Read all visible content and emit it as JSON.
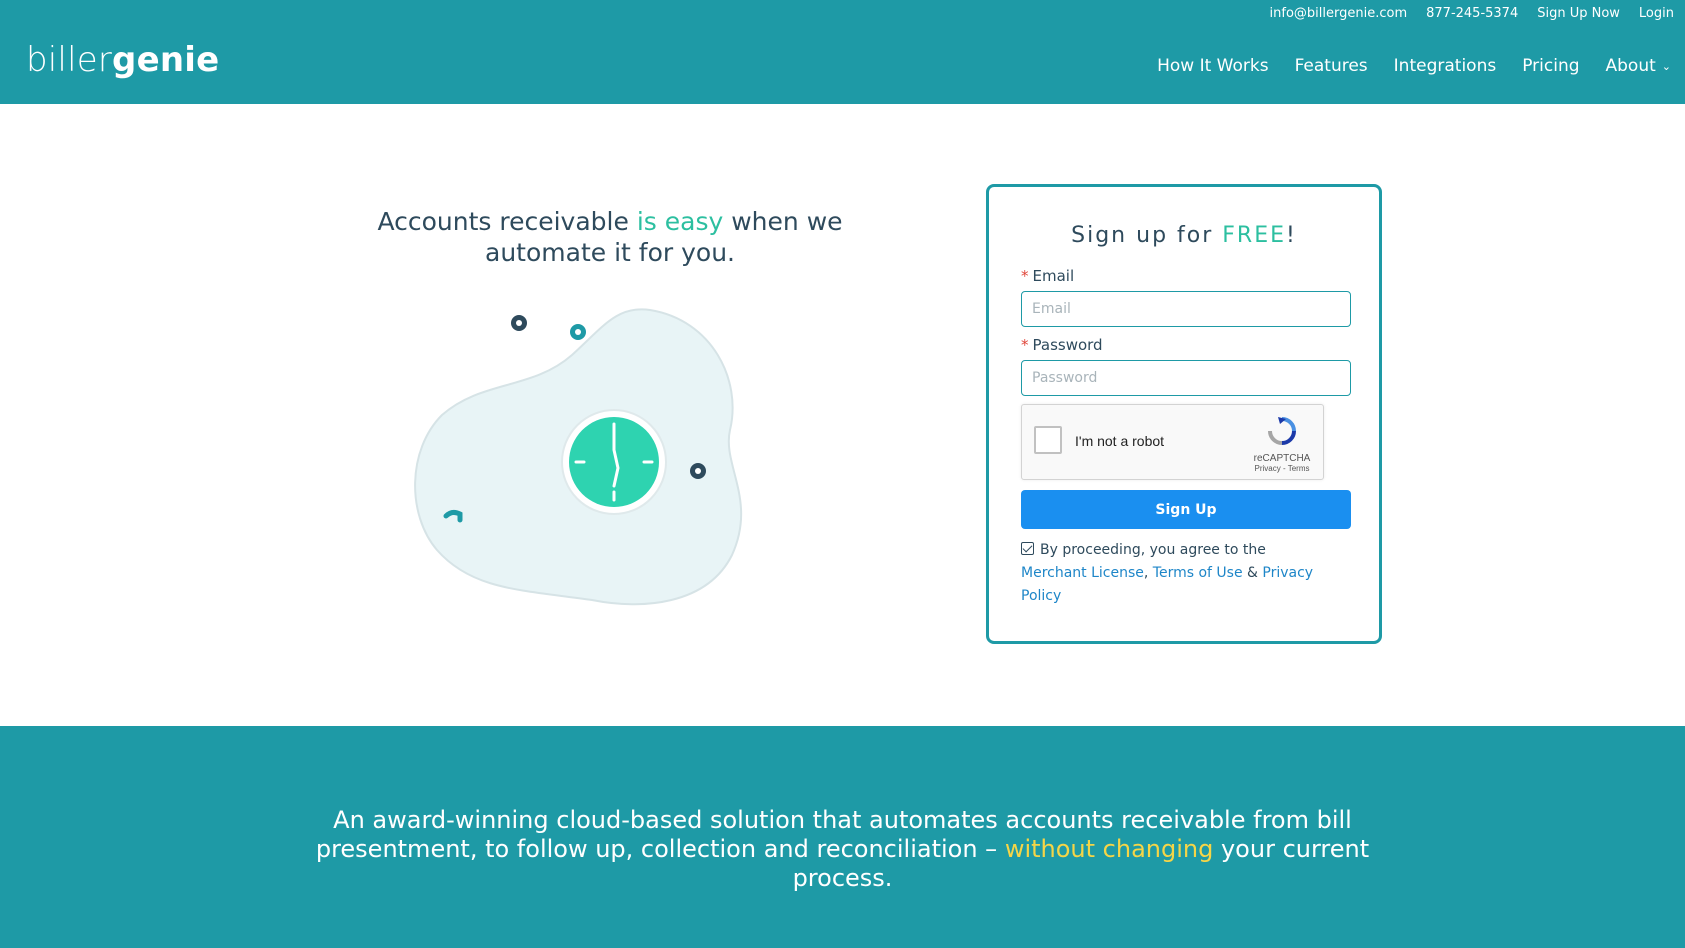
{
  "header": {
    "logo": {
      "part1": "biller",
      "part2": "genie"
    },
    "topbar": {
      "email": "info@billergenie.com",
      "phone": "877-245-5374",
      "signup": "Sign Up Now",
      "login": "Login"
    },
    "nav": {
      "how_it_works": "How It Works",
      "features": "Features",
      "integrations": "Integrations",
      "pricing": "Pricing",
      "about": "About"
    }
  },
  "hero": {
    "heading_part1": "Accounts receivable ",
    "heading_accent": "is easy",
    "heading_part2": " when we automate it for you."
  },
  "signup_card": {
    "title_part1": "Sign up for ",
    "title_accent": "FREE",
    "title_part2": "!",
    "email_label": "Email",
    "email_placeholder": "Email",
    "password_label": "Password",
    "password_placeholder": "Password",
    "captcha": {
      "text": "I'm not a robot",
      "brand": "reCAPTCHA",
      "links": "Privacy - Terms"
    },
    "button_label": "Sign Up",
    "agree_text": "By proceeding, you agree to the",
    "merchant_license": "Merchant License",
    "comma": ",",
    "terms_of_use": "Terms of Use",
    "amp": "&",
    "privacy_policy": "Privacy Policy"
  },
  "band": {
    "text_part1": "An award-winning cloud-based solution that automates accounts receivable from bill presentment, to follow up, collection and reconciliation – ",
    "text_accent": "without changing",
    "text_part2": " your current process."
  },
  "colors": {
    "brand_teal": "#1e9aa6",
    "accent_green": "#2cbfa0",
    "accent_yellow": "#f5d547",
    "button_blue": "#1a8ff0"
  }
}
